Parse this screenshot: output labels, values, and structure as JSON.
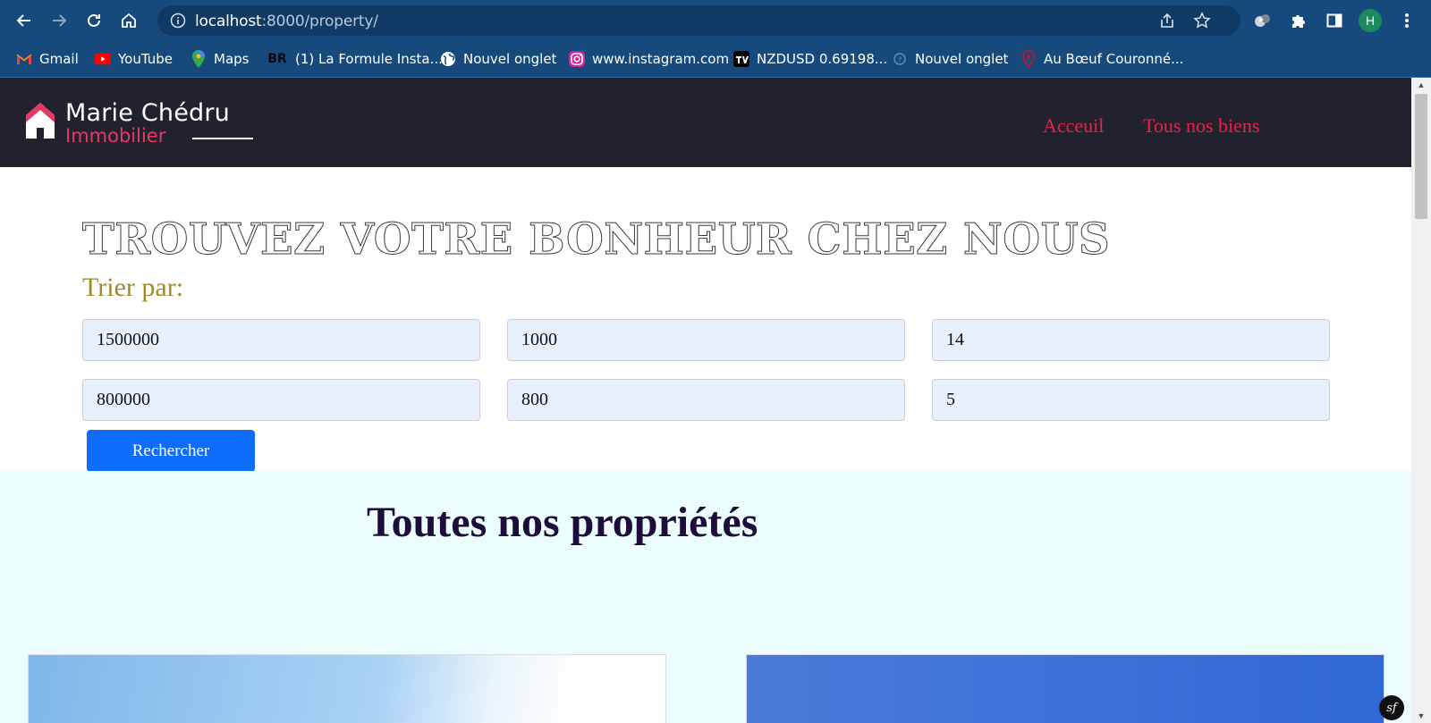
{
  "browser": {
    "url_host": "localhost",
    "url_port_path": ":8000/property/",
    "profile_initial": "H",
    "bookmarks": [
      {
        "icon": "gmail-icon",
        "label": "Gmail"
      },
      {
        "icon": "youtube-icon",
        "label": "YouTube"
      },
      {
        "icon": "maps-icon",
        "label": "Maps"
      },
      {
        "icon": "br-icon",
        "label": "(1) La Formule Insta..."
      },
      {
        "icon": "globe-icon",
        "label": "Nouvel onglet"
      },
      {
        "icon": "instagram-icon",
        "label": "www.instagram.com"
      },
      {
        "icon": "tradingview-icon",
        "label": "NZDUSD 0.69198..."
      },
      {
        "icon": "newtab-icon",
        "label": "Nouvel onglet"
      },
      {
        "icon": "restaurant-icon",
        "label": "Au Bœuf Couronné..."
      }
    ]
  },
  "site": {
    "logo_name": "Marie Chédru",
    "logo_sub": "Immobilier",
    "nav": [
      "Acceuil",
      "Tous nos biens"
    ]
  },
  "search": {
    "title": "TROUVEZ VOTRE BONHEUR CHEZ NOUS",
    "sort_label": "Trier par:",
    "row1": [
      "1500000",
      "1000",
      "14"
    ],
    "row2": [
      "800000",
      "800",
      "5"
    ],
    "button": "Rechercher"
  },
  "listing": {
    "title": "Toutes nos propriétés"
  },
  "badge": "sf",
  "colors": {
    "chrome": "#174a7c",
    "header_bg": "#22222f",
    "accent_red": "#e8214a",
    "button_blue": "#0d6efd",
    "listing_bg": "#ecfdfd"
  }
}
